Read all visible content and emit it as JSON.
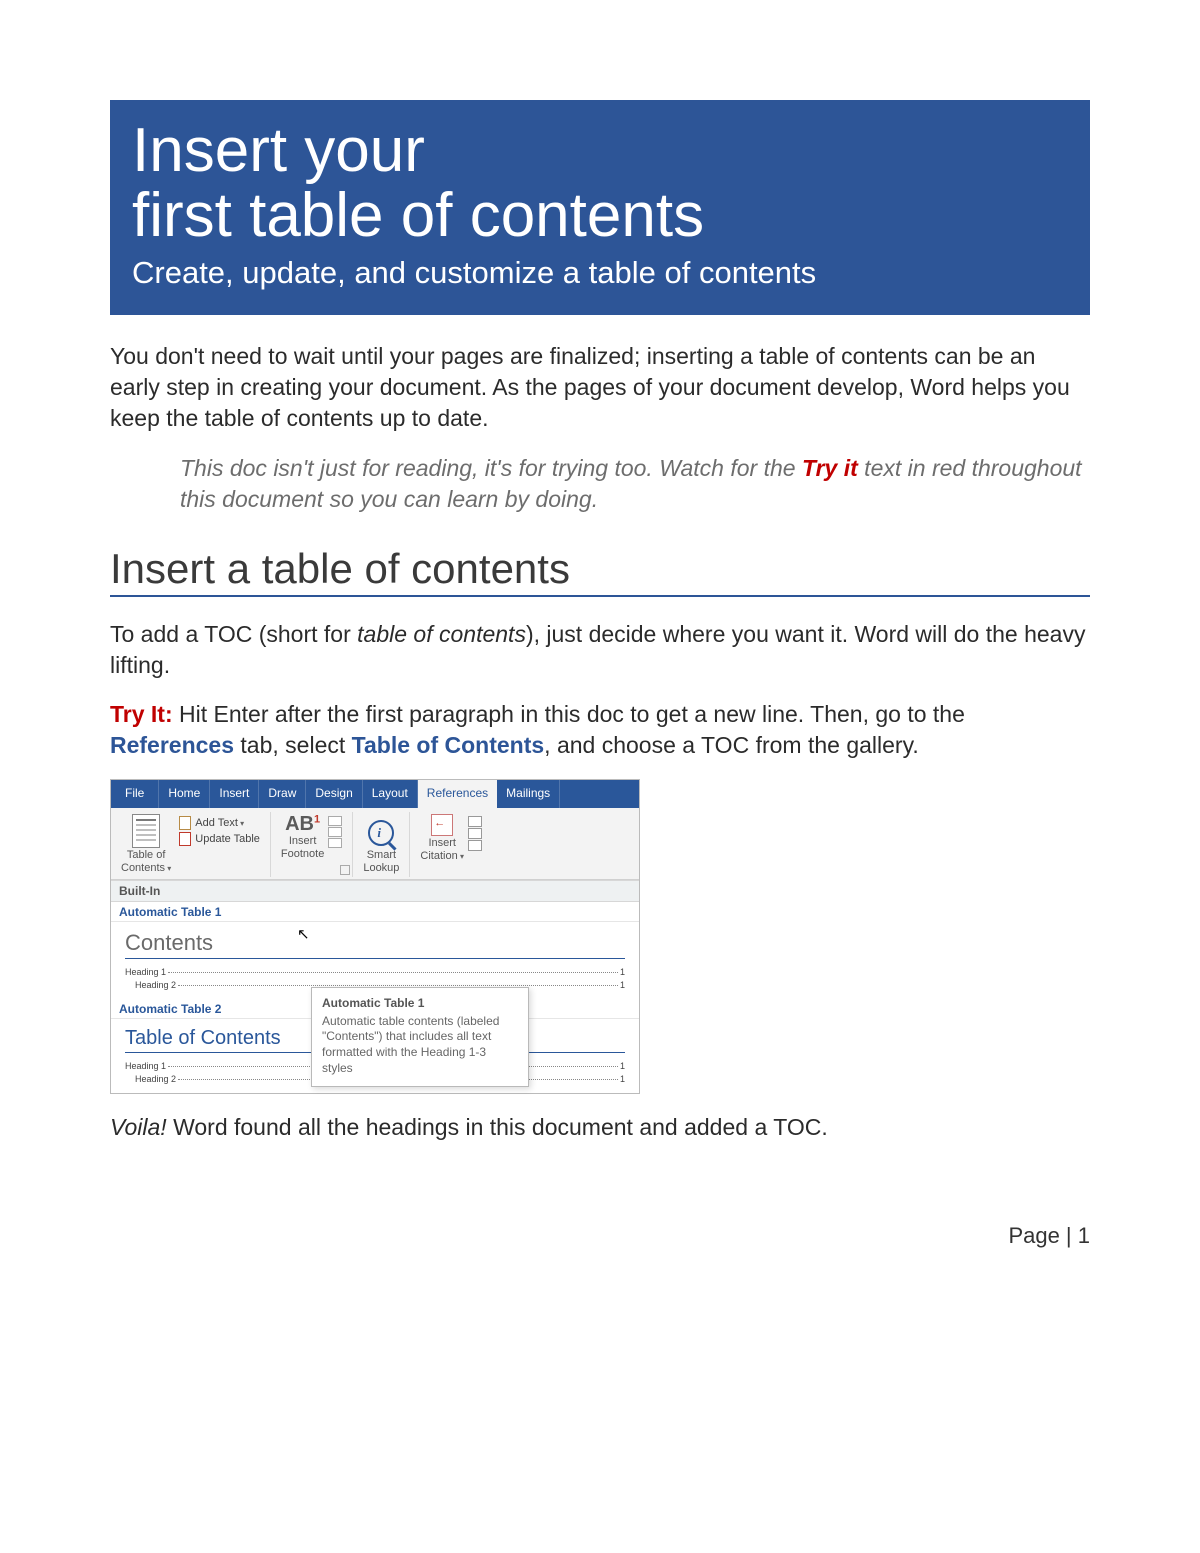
{
  "hero": {
    "title_line1": "Insert your",
    "title_line2": "first table of contents",
    "subtitle": "Create, update, and customize a table of contents"
  },
  "intro": "You don't need to wait until your pages are finalized; inserting a table of contents can be an early step in creating your document. As the pages of your document develop, Word helps you keep the table of contents up to date.",
  "callout": {
    "pre": "This doc isn't just for reading, it's for trying too. Watch for the ",
    "tryit": "Try it",
    "post": " text in red throughout this document so you can learn by doing."
  },
  "section_heading": "Insert a table of contents",
  "p1": {
    "pre": "To add a TOC (short for ",
    "term": "table of contents",
    "post": "), just decide where you want it. Word will do the heavy lifting."
  },
  "p2": {
    "tryit": "Try It:",
    "t1": " Hit Enter after the first paragraph in this doc to get a new line. Then, go to the ",
    "ref1": "References",
    "t2": " tab, select ",
    "ref2": "Table of Contents",
    "t3": ", and choose a TOC from the gallery."
  },
  "ribbon": {
    "tabs": [
      "File",
      "Home",
      "Insert",
      "Draw",
      "Design",
      "Layout",
      "References",
      "Mailings"
    ],
    "toc_label1": "Table of",
    "toc_label2": "Contents",
    "add_text": "Add Text",
    "update_table": "Update Table",
    "footnote1": "Insert",
    "footnote2": "Footnote",
    "smart1": "Smart",
    "smart2": "Lookup",
    "citation1": "Insert",
    "citation2": "Citation"
  },
  "gallery": {
    "builtin": "Built-In",
    "auto1": "Automatic Table 1",
    "auto2": "Automatic Table 2",
    "preview1_title": "Contents",
    "preview2_title": "Table of Contents",
    "h1": "Heading 1",
    "h2": "Heading 2",
    "page1": "1",
    "tooltip_title": "Automatic Table 1",
    "tooltip_body": "Automatic table contents (labeled \"Contents\") that includes all text formatted with the Heading 1-3 styles"
  },
  "voila_pre": "Voila!",
  "voila_post": " Word found all the headings in this document and added a TOC.",
  "footer": "Page | 1"
}
